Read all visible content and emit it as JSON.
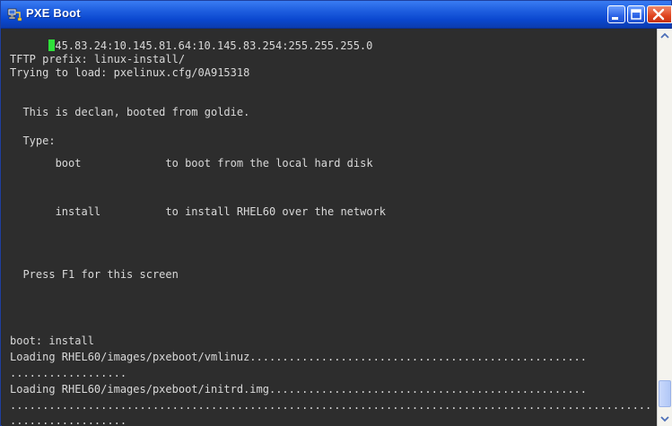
{
  "window": {
    "title": "PXE Boot"
  },
  "terminal": {
    "first_line_cursor_char": "1",
    "first_line_rest": "45.83.24:10.145.81.64:10.145.83.254:255.255.255.0",
    "lines": [
      "TFTP prefix: linux-install/",
      "Trying to load: pxelinux.cfg/0A915318",
      "  This is declan, booted from goldie.",
      "  Type:",
      "       boot             to boot from the local hard disk",
      "       install          to install RHEL60 over the network",
      "  Press F1 for this screen",
      "boot: install",
      "Loading RHEL60/images/pxeboot/vmlinuz....................................................",
      "..................",
      "Loading RHEL60/images/pxeboot/initrd.img.................................................",
      "...................................................................................................",
      ".................."
    ]
  },
  "icons": {
    "title_icon": "network-computer-icon",
    "minimize": "minimize-icon",
    "maximize": "maximize-icon",
    "close": "close-icon",
    "scroll_up": "scroll-up-arrow-icon",
    "scroll_down": "scroll-down-arrow-icon"
  },
  "colors": {
    "terminal_bg": "#2d2d2d",
    "terminal_text": "#d9d9d9",
    "cursor": "#2fe03a",
    "titlebar": "#1f5fe0"
  }
}
